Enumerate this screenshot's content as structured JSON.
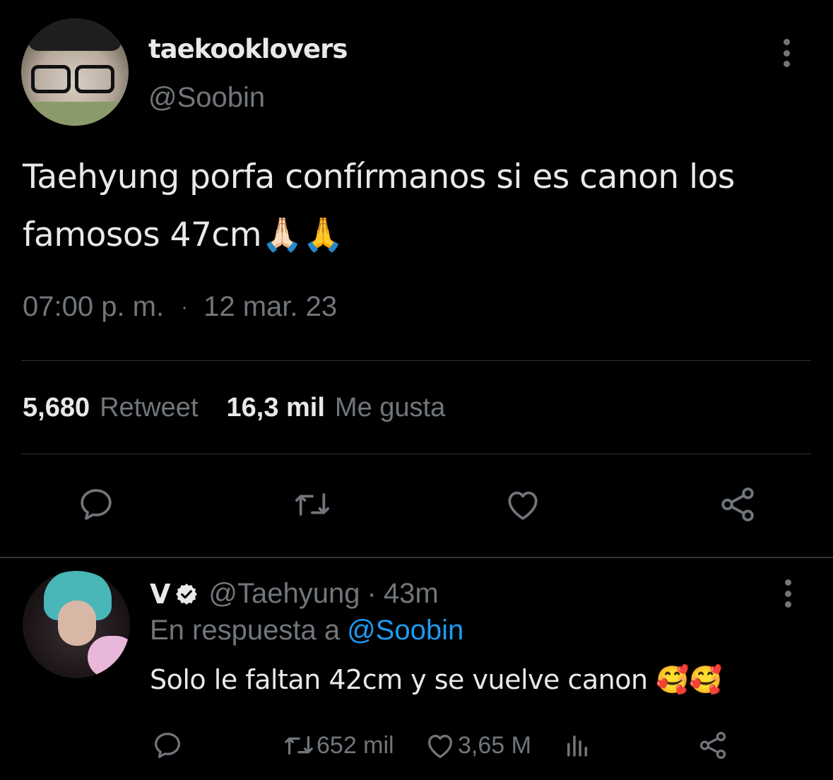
{
  "tweet": {
    "display_name": "taekooklovers",
    "handle": "@Soobin",
    "text_line1": "Taehyung porfa confírmanos si es canon los",
    "text_line2": "famosos 47cm",
    "emoji": "🙏🏻🙏",
    "time": "07:00 p. m.",
    "separator": "·",
    "date": "12 mar. 23",
    "retweets_count": "5,680",
    "retweets_label": "Retweet",
    "likes_count": "16,3 mil",
    "likes_label": "Me gusta"
  },
  "reply": {
    "display_name": "V",
    "handle": "@Taehyung",
    "separator": "·",
    "time": "43m",
    "in_reply_prefix": "En respuesta a",
    "in_reply_mention": "@Soobin",
    "text": "Solo le faltan 42cm y se vuelve canon",
    "emoji": "🥰🥰",
    "retweets_count": "652 mil",
    "likes_count": "3,65 M"
  },
  "colors": {
    "background": "#000000",
    "text_primary": "#e7e9ea",
    "text_secondary": "#71767b",
    "accent": "#1d9bf0",
    "divider": "#2f3336"
  },
  "icons": [
    "more-icon",
    "reply-icon",
    "retweet-icon",
    "like-icon",
    "share-icon",
    "verified-badge-icon",
    "analytics-icon"
  ]
}
